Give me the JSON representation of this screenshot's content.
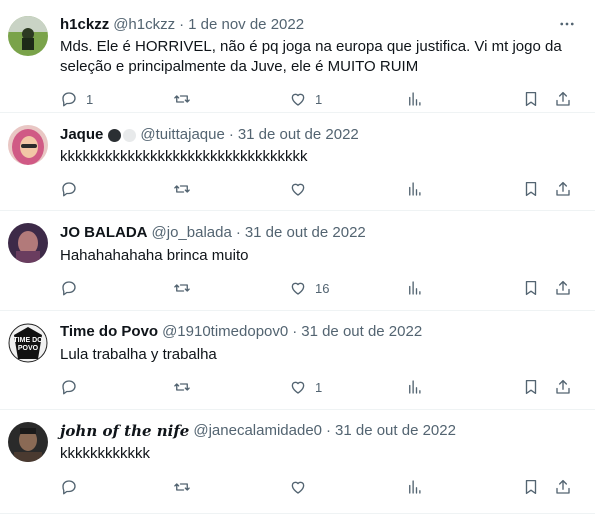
{
  "colors": {
    "text": "#0f1419",
    "secondary": "#536471",
    "divider": "#eff3f4",
    "icon": "#536471"
  },
  "tweets": [
    {
      "name": "h1ckzz",
      "handle": "@h1ckzz",
      "separator": "·",
      "date": "1 de nov de 2022",
      "text": "Mds. Ele é HORRIVEL, não é pq joga na europa que justifica. Vi mt jogo da seleção e principalmente da Juve, ele é MUITO RUIM",
      "reply_count": "1",
      "retweet_count": "",
      "like_count": "1",
      "avatar": "green-field-photo"
    },
    {
      "name": "Jaque",
      "badges": [
        "black-circle",
        "white-circle"
      ],
      "handle": "@tuittajaque",
      "separator": "·",
      "date": "31 de out de 2022",
      "text": "kkkkkkkkkkkkkkkkkkkkkkkkkkkkkkkkk",
      "reply_count": "",
      "retweet_count": "",
      "like_count": "",
      "avatar": "pink-hair-photo"
    },
    {
      "name": "JO BALADA",
      "handle": "@jo_balada",
      "separator": "·",
      "date": "31 de out de 2022",
      "text": "Hahahahahaha brinca muito",
      "reply_count": "",
      "retweet_count": "",
      "like_count": "16",
      "avatar": "purple-photo"
    },
    {
      "name": "Time do Povo",
      "handle": "@1910timedopov0",
      "separator": "·",
      "date": "31 de out de 2022",
      "text": "Lula trabalha y trabalha",
      "reply_count": "",
      "retweet_count": "",
      "like_count": "1",
      "avatar": "time-do-povo-logo",
      "avatar_text": "TIME DO POVO"
    },
    {
      "name": "john of the nife",
      "handle": "@janecalamidade0",
      "separator": "·",
      "date": "31 de out de 2022",
      "text": "kkkkkkkkkkkk",
      "reply_count": "",
      "retweet_count": "",
      "like_count": "",
      "avatar": "dark-photo"
    }
  ]
}
